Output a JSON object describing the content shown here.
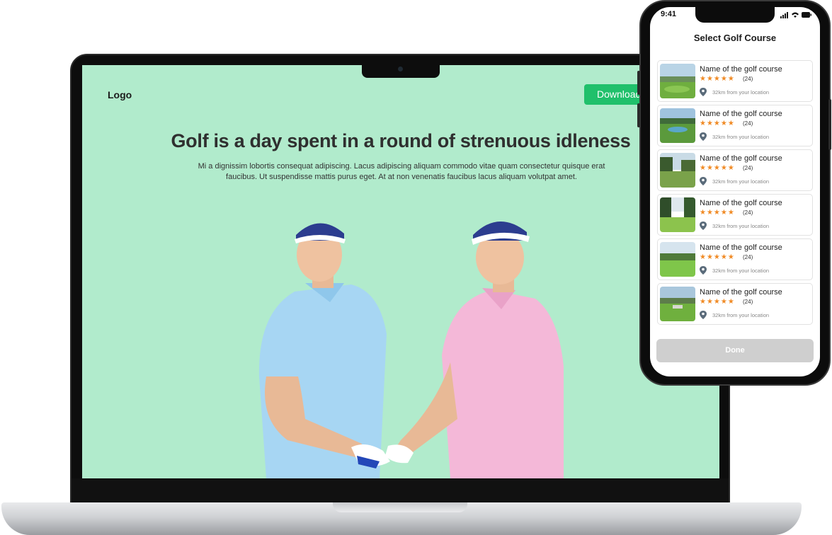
{
  "website": {
    "logo": "Logo",
    "download_button": "Download",
    "hero_title": "Golf is a day spent in a round of strenuous idleness",
    "hero_description": "Mi a dignissim lobortis consequat adipiscing. Lacus adipiscing aliquam commodo vitae quam consectetur quisque erat faucibus. Ut suspendisse mattis purus eget. At at non venenatis faucibus lacus aliquam volutpat amet.",
    "background_color": "#b1ebcc",
    "accent_color": "#20c06b"
  },
  "phone": {
    "status_time": "9:41",
    "title": "Select Golf Course",
    "done_button": "Done",
    "courses": [
      {
        "name": "Name of the golf course",
        "stars": "★★★★★",
        "reviews": "(24)",
        "distance": "32km from your location"
      },
      {
        "name": "Name of the golf course",
        "stars": "★★★★★",
        "reviews": "(24)",
        "distance": "32km from your location"
      },
      {
        "name": "Name of the golf course",
        "stars": "★★★★★",
        "reviews": "(24)",
        "distance": "32km from your location"
      },
      {
        "name": "Name of the golf course",
        "stars": "★★★★★",
        "reviews": "(24)",
        "distance": "32km from your location"
      },
      {
        "name": "Name of the golf course",
        "stars": "★★★★★",
        "reviews": "(24)",
        "distance": "32km from your location"
      },
      {
        "name": "Name of the golf course",
        "stars": "★★★★★",
        "reviews": "(24)",
        "distance": "32km from your location"
      }
    ]
  }
}
